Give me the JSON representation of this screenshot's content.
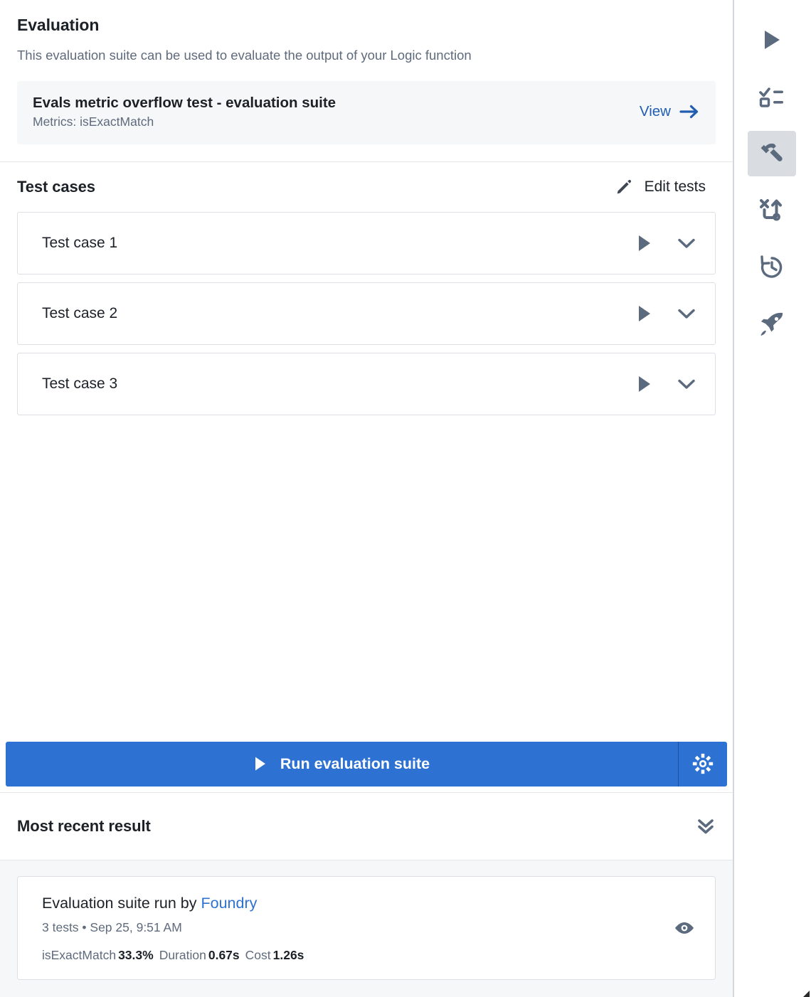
{
  "evaluation": {
    "title": "Evaluation",
    "description": "This evaluation suite can be used to evaluate the output of your Logic function",
    "suite": {
      "name": "Evals metric overflow test - evaluation suite",
      "metrics_label": "Metrics: isExactMatch",
      "view_label": "View",
      "view_icon": "arrow-right-icon"
    }
  },
  "test_cases": {
    "title": "Test cases",
    "edit_label": "Edit tests",
    "edit_icon": "pencil-icon",
    "rows": [
      {
        "label": "Test case 1",
        "run_icon": "play-icon",
        "expand_icon": "chevron-down-icon"
      },
      {
        "label": "Test case 2",
        "run_icon": "play-icon",
        "expand_icon": "chevron-down-icon"
      },
      {
        "label": "Test case 3",
        "run_icon": "play-icon",
        "expand_icon": "chevron-down-icon"
      }
    ]
  },
  "run_bar": {
    "label": "Run evaluation suite",
    "play_icon": "play-icon",
    "settings_icon": "gear-icon",
    "accent_color": "#2d72d2"
  },
  "recent_result": {
    "title": "Most recent result",
    "collapse_icon": "double-chevron-down-icon",
    "card": {
      "run_by_prefix": "Evaluation suite run by ",
      "author": "Foundry",
      "meta": "3 tests • Sep 25, 9:51 AM",
      "stats": [
        {
          "label": "isExactMatch",
          "value": "33.3%"
        },
        {
          "label": "Duration",
          "value": "0.67s"
        },
        {
          "label": "Cost",
          "value": "1.26s"
        }
      ],
      "view_icon": "eye-icon"
    }
  },
  "rail": {
    "items": [
      {
        "name": "run",
        "icon": "play-icon",
        "active": false
      },
      {
        "name": "tests",
        "icon": "checklist-icon",
        "active": false
      },
      {
        "name": "build",
        "icon": "hammer-icon",
        "active": true
      },
      {
        "name": "variables",
        "icon": "strategy-icon",
        "active": false
      },
      {
        "name": "history",
        "icon": "history-icon",
        "active": false
      },
      {
        "name": "publish",
        "icon": "rocket-icon",
        "active": false
      }
    ]
  },
  "colors": {
    "accent": "#2d72d2",
    "link": "#215db0",
    "text": "#1c2127",
    "muted": "#5f6b7c",
    "border": "#dcdfe3",
    "surface": "#f6f7f9",
    "active_rail": "#d9dce1"
  }
}
